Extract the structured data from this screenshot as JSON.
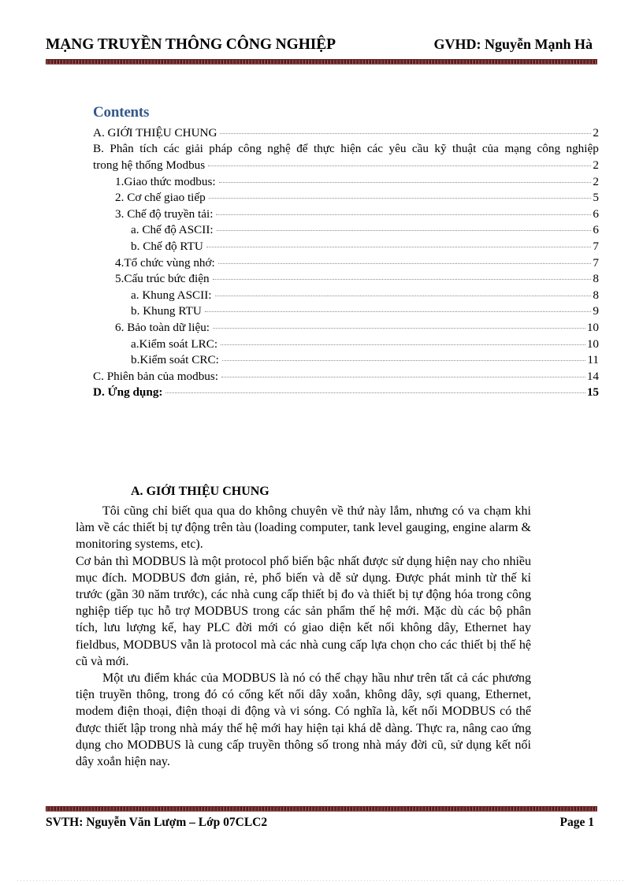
{
  "header": {
    "left_title": "MẠNG TRUYỀN THÔNG CÔNG NGHIỆP",
    "right_title": "GVHD: Nguyễn Mạnh Hà"
  },
  "footer": {
    "left": "SVTH: Nguyễn Văn Lượm – Lớp 07CLC2",
    "right": "Page 1"
  },
  "contents": {
    "title": "Contents",
    "entries": [
      {
        "label": "A.    GIỚI THIỆU  CHUNG",
        "page": "2",
        "indent": 0,
        "bold": false
      },
      {
        "label": "1.Giao thức modbus:",
        "page": "2",
        "indent": 1,
        "bold": false
      },
      {
        "label": "2. Cơ chế giao  tiếp",
        "page": "5",
        "indent": 1,
        "bold": false
      },
      {
        "label": "3. Chế độ truyền  tải:",
        "page": "6",
        "indent": 1,
        "bold": false
      },
      {
        "label": "a.     Chế độ ASCII:",
        "page": "6",
        "indent": 2,
        "bold": false
      },
      {
        "label": "b.        Chế độ RTU",
        "page": "7",
        "indent": 2,
        "bold": false
      },
      {
        "label": "4.Tổ chức vùng  nhớ:",
        "page": "7",
        "indent": 1,
        "bold": false
      },
      {
        "label": "5.Cấu trúc bức điện",
        "page": "8",
        "indent": 1,
        "bold": false
      },
      {
        "label": "a. Khung  ASCII:",
        "page": "8",
        "indent": 2,
        "bold": false
      },
      {
        "label": "b. Khung  RTU",
        "page": "9",
        "indent": 2,
        "bold": false
      },
      {
        "label": "6. Bảo toàn dữ liệu:",
        "page": "10",
        "indent": 1,
        "bold": false
      },
      {
        "label": "a.Kiểm  soát LRC:",
        "page": "10",
        "indent": 2,
        "bold": false
      },
      {
        "label": "b.Kiểm  soát CRC:",
        "page": "11",
        "indent": 2,
        "bold": false
      },
      {
        "label": "C.  Phiên  bản của modbus:",
        "page": "14",
        "indent": 0,
        "bold": false
      },
      {
        "label": "D. Ứng dụng:",
        "page": "15",
        "indent": 0,
        "bold": true
      }
    ],
    "entry_b": {
      "line1_words": [
        "B.",
        "Phân",
        "tích",
        "các",
        "giải",
        "pháp",
        "công",
        "nghệ",
        "để",
        "thực",
        "hiện",
        "các",
        "yêu",
        "cầu",
        "kỹ",
        "thuật",
        "của",
        "mạng",
        "công",
        "nghiệp"
      ],
      "line2_label": "trong hệ thống  Modbus",
      "page": "2"
    }
  },
  "body": {
    "section_letter": "A.",
    "section_title": "GIỚI THIỆU  CHUNG",
    "paragraphs": [
      "Tôi cũng chỉ biết qua  qua do không chuyên về thứ này lắm, nhưng có va chạm khi làm về các thiết bị tự động trên tàu (loading computer, tank  level gauging, engine alarm & monitoring systems, etc).",
      "Cơ bản thì MODBUS  là  một protocol phổ biến bậc nhất được sử dụng hiện nay cho nhiều mục đích. MODBUS đơn giản, rẻ, phổ biến và dễ sử dụng. Được phát minh từ thế kỉ trước (gần 30 năm trước), các nhà  cung cấp thiết bị đo và thiết bị tự động hóa trong công nghiệp tiếp tục hỗ trợ MODBUS  trong các sản phẩm thế hệ mới. Mặc dù các bộ phân tích, lưu lượng kế, hay PLC đời mới có giao diện kết nối không dây, Ethernet hay fieldbus, MODBUS vẫn  là protocol mà các nhà cung cấp lựa chọn cho các thiết bị thế hệ cũ và mới.",
      "Một ưu điểm khác của MODBUS  là nó có thể chạy hầu như trên tất cả các phương tiện truyền thông, trong đó có cổng kết nối dây xoắn, không dây, sợi quang, Ethernet, modem điện thoại, điện thoại di động và vi sóng. Có nghĩa là, kết nối MODBUS có thể được thiết lập trong nhà máy thế hệ mới hay hiện tại khá dễ dàng. Thực ra, nâng cao ứng dụng cho MODBUS là cung cấp truyền thông số trong nhà máy đời cũ, sử dụng kết nối dây xoắn hiện nay."
    ]
  },
  "colors": {
    "rule": "#7a2121",
    "contents_heading": "#34588a",
    "text": "#000000",
    "leader_dots": "#8d8d8d"
  }
}
